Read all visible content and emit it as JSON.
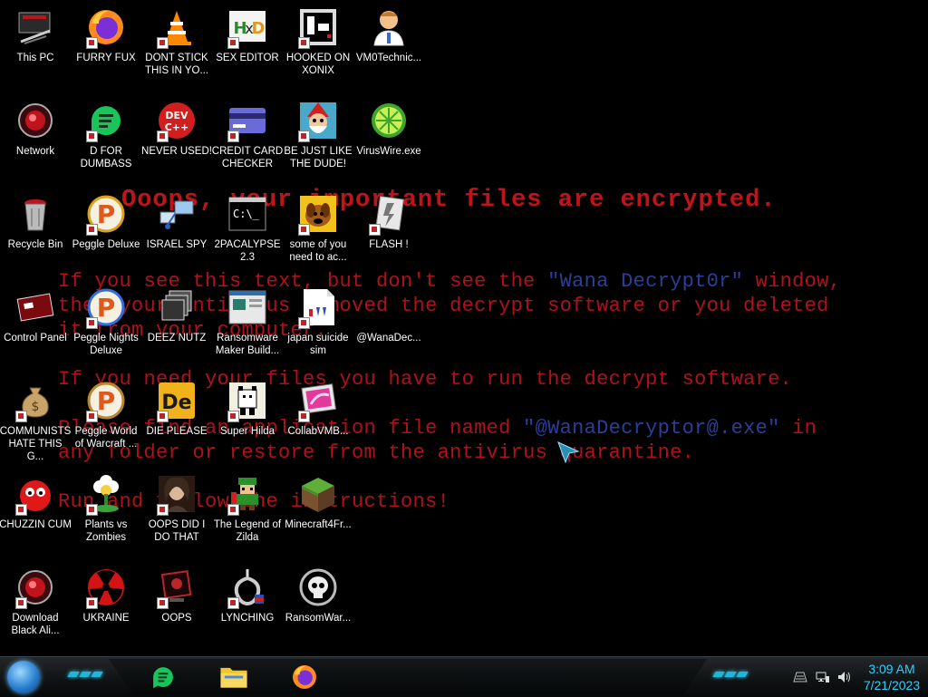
{
  "wallpaper": {
    "headline": "Ooops, your important files are encrypted.",
    "lines": [
      {
        "parts": [
          "If you see this text, but don't see the ",
          "\"Wana Decrypt0r\"",
          " window,"
        ]
      },
      {
        "parts": [
          "then your antivirus removed the decrypt software or you deleted",
          "",
          ""
        ]
      },
      {
        "parts": [
          "it from your computer.",
          "",
          ""
        ]
      },
      {
        "parts": [
          "If you need your files you have to run the decrypt software.",
          "",
          ""
        ]
      },
      {
        "parts": [
          "Please find an application file named ",
          "\"@WanaDecryptor@.exe\"",
          " in"
        ]
      },
      {
        "parts": [
          "any folder or restore from the antivirus quarantine.",
          "",
          ""
        ]
      },
      {
        "parts": [
          "Run and follow the instructions!",
          "",
          ""
        ]
      }
    ]
  },
  "icons": [
    {
      "label": "This PC",
      "icon": "this-pc-icon"
    },
    {
      "label": "FURRY FUX",
      "icon": "firefox-icon"
    },
    {
      "label": "DONT STICK THIS IN YO...",
      "icon": "vlc-cone-icon"
    },
    {
      "label": "SEX EDITOR",
      "icon": "hxd-editor-icon"
    },
    {
      "label": "HOOKED ON XONIX",
      "icon": "xonix-game-icon"
    },
    {
      "label": "VM0Technic...",
      "icon": "doctor-avatar-icon"
    },
    {
      "label": "Network",
      "icon": "network-orb-icon"
    },
    {
      "label": "D FOR DUMBASS",
      "icon": "green-app-icon"
    },
    {
      "label": "NEVER USED!",
      "icon": "devcpp-icon"
    },
    {
      "label": "CREDIT CARD CHECKER",
      "icon": "credit-card-icon"
    },
    {
      "label": "BE JUST LIKE THE DUDE!",
      "icon": "santa-elf-icon"
    },
    {
      "label": "VirusWire.exe",
      "icon": "lime-icon"
    },
    {
      "label": "Recycle Bin",
      "icon": "recycle-bin-icon"
    },
    {
      "label": "Peggle Deluxe",
      "icon": "peggle-icon"
    },
    {
      "label": "ISRAEL SPY",
      "icon": "spy-network-icon"
    },
    {
      "label": "2PACALYPSE 2.3",
      "icon": "terminal-icon"
    },
    {
      "label": "some of you need to ac...",
      "icon": "cartoon-dog-icon"
    },
    {
      "label": "FLASH !",
      "icon": "flash-card-icon"
    },
    {
      "label": "Control Panel",
      "icon": "control-panel-icon"
    },
    {
      "label": "Peggle Nights Deluxe",
      "icon": "peggle-nights-icon"
    },
    {
      "label": "DEEZ NUTZ",
      "icon": "stacked-windows-icon"
    },
    {
      "label": "Ransomware Maker Build...",
      "icon": "ransomware-builder-icon"
    },
    {
      "label": "japan suicide sim",
      "icon": "document-icon"
    },
    {
      "label": "@WanaDec...",
      "icon": "blank-icon"
    },
    {
      "label": "COMMUNISTS HATE THIS G...",
      "icon": "money-bag-icon"
    },
    {
      "label": "Peggle World of Warcraft ...",
      "icon": "peggle-wow-icon"
    },
    {
      "label": "DIE PLEASE",
      "icon": "de-logo-icon"
    },
    {
      "label": "Super Hilda",
      "icon": "pixel-cat-icon"
    },
    {
      "label": "CollabVMB...",
      "icon": "collab-vm-icon"
    },
    {
      "label": "CHUZZIN CUM",
      "icon": "chuzzle-icon"
    },
    {
      "label": "Plants vs Zombies",
      "icon": "pvz-flower-icon"
    },
    {
      "label": "OOPS DID I DO THAT",
      "icon": "portrait-icon"
    },
    {
      "label": "The Legend of Zilda",
      "icon": "pixel-hero-icon"
    },
    {
      "label": "Minecraft4Fr...",
      "icon": "minecraft-block-icon"
    },
    {
      "label": "Download Black Ali...",
      "icon": "network-orb-icon"
    },
    {
      "label": "UKRAINE",
      "icon": "radiation-icon"
    },
    {
      "label": "OOPS",
      "icon": "red-monitor-icon"
    },
    {
      "label": "LYNCHING",
      "icon": "noose-icon"
    },
    {
      "label": "RansomWar...",
      "icon": "skull-icon"
    }
  ],
  "taskbar": {
    "start": "start-orb-icon",
    "apps": [
      {
        "name": "green-app-icon"
      },
      {
        "name": "file-explorer-icon"
      },
      {
        "name": "firefox-icon"
      }
    ],
    "tray": [
      "action-center-icon",
      "network-tray-icon",
      "volume-icon"
    ],
    "time": "3:09 AM",
    "date": "7/21/2023"
  },
  "colors": {
    "wallpaper_text": "#b0111a",
    "highlight_text": "#2b3f9a",
    "clock": "#2bd0ff",
    "accent": "#1fb7d9"
  }
}
